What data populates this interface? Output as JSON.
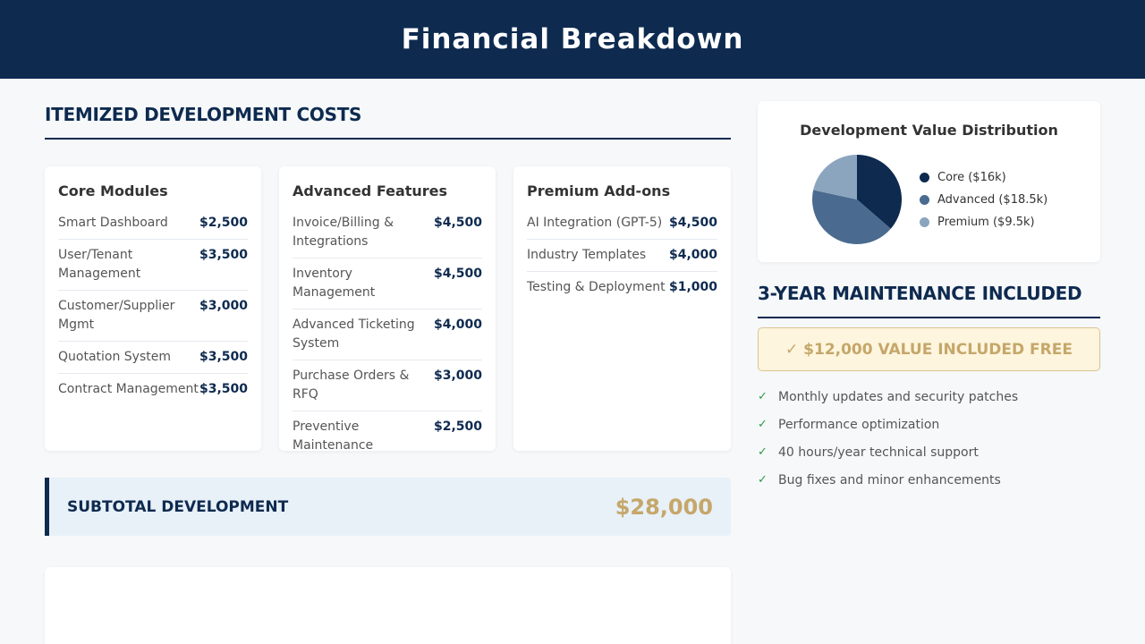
{
  "header": {
    "title": "Financial Breakdown"
  },
  "costs": {
    "section_title": "ITEMIZED DEVELOPMENT COSTS",
    "modules": [
      {
        "title": "Core Modules",
        "items": [
          {
            "label": "Smart Dashboard",
            "price": "$2,500"
          },
          {
            "label": "User/Tenant Management",
            "price": "$3,500"
          },
          {
            "label": "Customer/Supplier Mgmt",
            "price": "$3,000"
          },
          {
            "label": "Quotation System",
            "price": "$3,500"
          },
          {
            "label": "Contract Management",
            "price": "$3,500"
          }
        ]
      },
      {
        "title": "Advanced Features",
        "items": [
          {
            "label": "Invoice/Billing & Integrations",
            "price": "$4,500"
          },
          {
            "label": "Inventory Management",
            "price": "$4,500"
          },
          {
            "label": "Advanced Ticketing System",
            "price": "$4,000"
          },
          {
            "label": "Purchase Orders & RFQ",
            "price": "$3,000"
          },
          {
            "label": "Preventive Maintenance",
            "price": "$2,500"
          }
        ]
      },
      {
        "title": "Premium Add-ons",
        "items": [
          {
            "label": "AI Integration (GPT-5)",
            "price": "$4,500"
          },
          {
            "label": "Industry Templates",
            "price": "$4,000"
          },
          {
            "label": "Testing & Deployment",
            "price": "$1,000"
          }
        ]
      }
    ],
    "subtotal": {
      "label": "SUBTOTAL DEVELOPMENT",
      "amount": "$28,000"
    }
  },
  "chart_data": {
    "type": "pie",
    "title": "Development Value Distribution",
    "categories": [
      "Core ($16k)",
      "Advanced ($18.5k)",
      "Premium ($9.5k)"
    ],
    "values": [
      16,
      18.5,
      9.5
    ],
    "colors": [
      "#0e2a4f",
      "#4a6b8f",
      "#8ca5bf"
    ],
    "legend_position": "right"
  },
  "maintenance": {
    "section_title": "3-YEAR MAINTENANCE INCLUDED",
    "banner": "✓ $12,000 VALUE INCLUDED FREE",
    "check_icon": "✓",
    "items": [
      "Monthly updates and security patches",
      "Performance optimization",
      "40 hours/year technical support",
      "Bug fixes and minor enhancements"
    ]
  },
  "colors": {
    "navy": "#0e2a4f",
    "gold": "#c5a76a",
    "green": "#2c9a4a"
  }
}
